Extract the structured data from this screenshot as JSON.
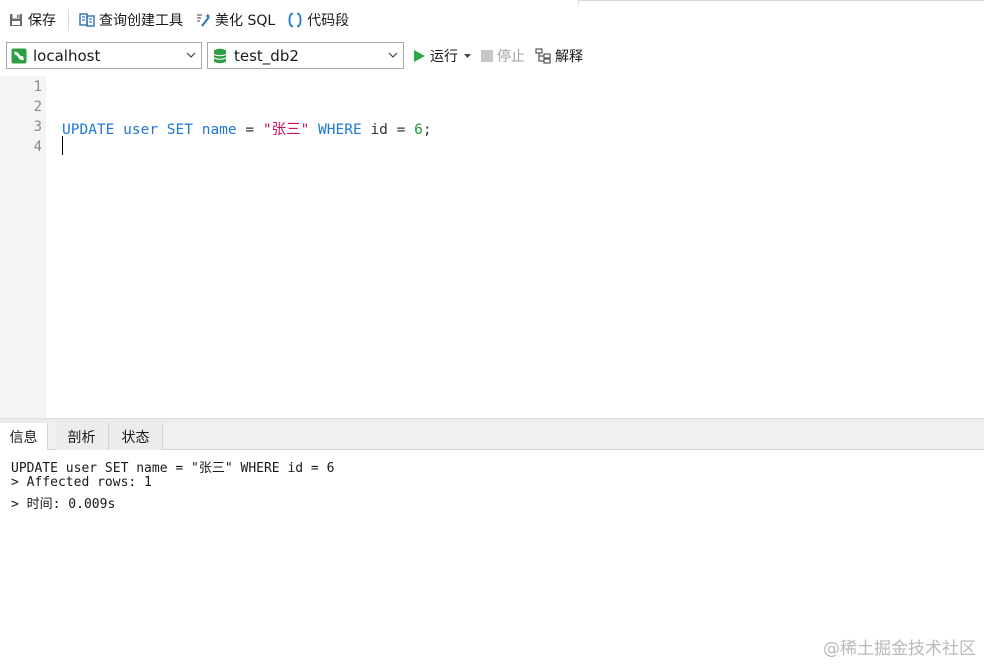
{
  "toolbar": {
    "save_label": "保存",
    "query_builder_label": "查询创建工具",
    "beautify_label": "美化 SQL",
    "snippet_label": "代码段"
  },
  "connection": {
    "selected": "localhost",
    "database": "test_db2"
  },
  "run_controls": {
    "run_label": "运行",
    "stop_label": "停止",
    "explain_label": "解释"
  },
  "editor": {
    "line_numbers": [
      "1",
      "2",
      "3",
      "4"
    ],
    "query": {
      "kw_update": "UPDATE",
      "table": "user",
      "kw_set": "SET",
      "column": "name",
      "eq1": "=",
      "value": "\"张三\"",
      "kw_where": "WHERE",
      "cond_col": "id",
      "eq2": "=",
      "cond_val": "6",
      "semicolon": ";"
    }
  },
  "result_tabs": [
    "信息",
    "剖析",
    "状态"
  ],
  "messages": [
    "UPDATE user SET name = \"张三\" WHERE id = 6",
    "> Affected rows: 1",
    "> 时间: 0.009s"
  ],
  "watermark": "@稀土掘金技术社区",
  "colors": {
    "keyword": "#1f78d1",
    "string": "#c8115c",
    "number": "#1f9b3a",
    "run_green": "#2aa84a",
    "db_green": "#2e9e44"
  }
}
